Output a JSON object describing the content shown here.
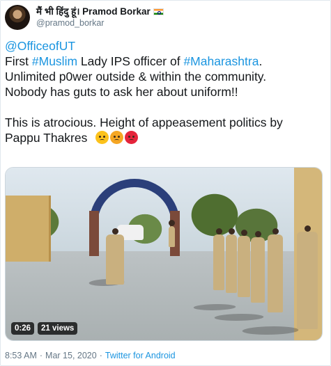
{
  "author": {
    "display_name": "मैं भी हिंदु हूं। Pramod Borkar",
    "handle": "@pramod_borkar",
    "avatar_icon": "profile-photo"
  },
  "tweet": {
    "mention": "@OfficeofUT",
    "line1_prefix": "First ",
    "hashtag1": "#Muslim",
    "line1_middle": " Lady IPS officer of ",
    "hashtag2": "#Maharashtra",
    "line1_suffix": ".",
    "line2": "Unlimited p0wer outside & within the community.",
    "line3": "Nobody has guts to ask her about uniform!!",
    "line4": "This is atrocious. Height of appeasement politics by",
    "line5": "Pappu Thakres",
    "emojis": [
      "frowning-face-icon",
      "angry-face-icon",
      "pouting-face-icon"
    ]
  },
  "video": {
    "duration": "0:26",
    "views": "21 views"
  },
  "meta": {
    "time": "8:53 AM",
    "separator": "·",
    "date": "Mar 15, 2020",
    "source": "Twitter for Android"
  },
  "colors": {
    "link": "#1b95e0",
    "muted": "#657786",
    "text": "#14171a"
  }
}
